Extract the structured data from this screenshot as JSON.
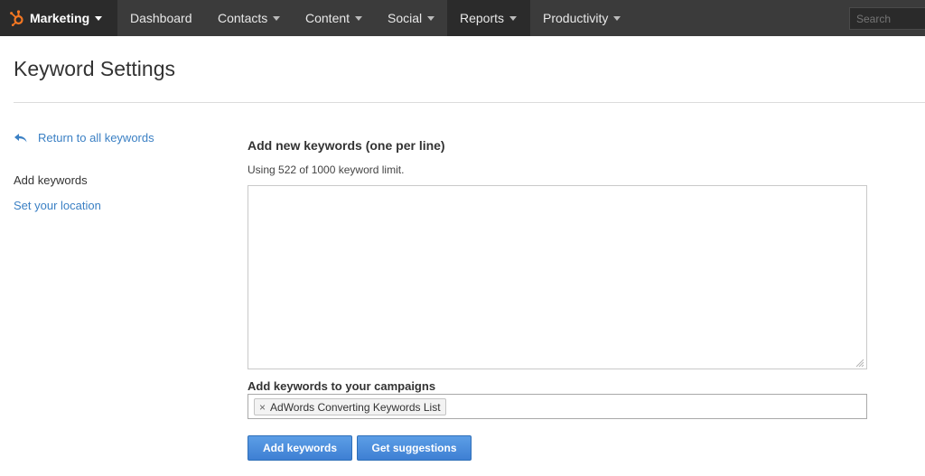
{
  "nav": {
    "brand": "Marketing",
    "items": [
      {
        "label": "Dashboard"
      },
      {
        "label": "Contacts"
      },
      {
        "label": "Content"
      },
      {
        "label": "Social"
      },
      {
        "label": "Reports"
      },
      {
        "label": "Productivity"
      }
    ],
    "active": "Reports",
    "search_placeholder": "Search"
  },
  "page": {
    "title": "Keyword Settings"
  },
  "sidebar": {
    "return_label": "Return to all keywords",
    "current_label": "Add keywords",
    "location_label": "Set your location"
  },
  "main": {
    "heading": "Add new keywords (one per line)",
    "usage": "Using 522 of 1000 keyword limit.",
    "keywords_value": "",
    "campaign_label": "Add keywords to your campaigns",
    "campaign_token": "AdWords Converting Keywords List",
    "token_remove": "×",
    "add_button": "Add keywords",
    "suggest_button": "Get suggestions"
  },
  "colors": {
    "nav_bg": "#3b3b3b",
    "nav_active_bg": "#2b2b2b",
    "brand_accent": "#f57722",
    "link": "#3b80c4",
    "button": "#4a8ad9"
  },
  "icons": {
    "brand": "sprocket-logo-icon",
    "return": "reply-arrow-icon",
    "resize": "resize-grip-icon"
  }
}
